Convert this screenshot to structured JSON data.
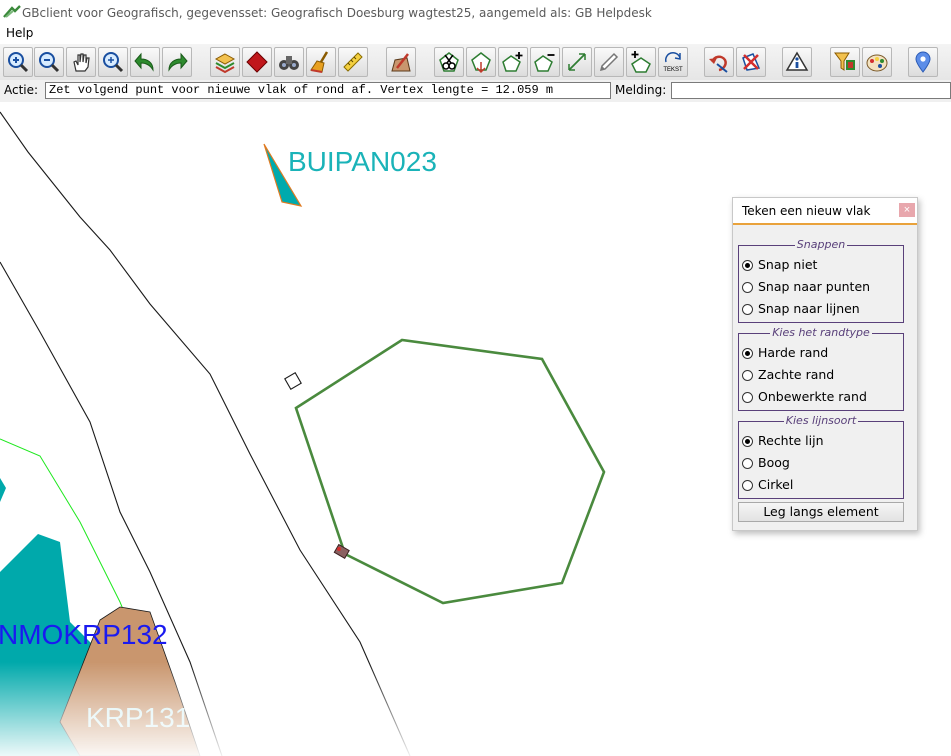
{
  "window": {
    "title": "GBclient voor Geografisch, gegevensset: Geografisch Doesburg wagtest25, aangemeld als: GB Helpdesk"
  },
  "menu": {
    "items": [
      {
        "label": "Help"
      }
    ]
  },
  "toolbar": {
    "buttons": [
      {
        "icon": "zoom-in-icon"
      },
      {
        "icon": "zoom-out-icon"
      },
      {
        "icon": "pan-hand-icon"
      },
      {
        "icon": "zoom-extent-icon"
      },
      {
        "icon": "undo-arrow-icon"
      },
      {
        "icon": "redo-arrow-icon"
      },
      {
        "icon": "layers-icon"
      },
      {
        "icon": "polygon-fill-icon"
      },
      {
        "icon": "binoculars-icon"
      },
      {
        "icon": "broom-icon"
      },
      {
        "icon": "ruler-icon"
      },
      {
        "icon": "edit-object-icon"
      },
      {
        "icon": "cut-icon"
      },
      {
        "icon": "vertex-move-icon"
      },
      {
        "icon": "add-vertex-icon"
      },
      {
        "icon": "remove-vertex-icon"
      },
      {
        "icon": "edit-line-icon"
      },
      {
        "icon": "pen-icon"
      },
      {
        "icon": "add-polygon-icon"
      },
      {
        "icon": "rotate-text-icon"
      },
      {
        "icon": "undo-edit-icon"
      },
      {
        "icon": "delete-icon"
      },
      {
        "icon": "info-icon"
      },
      {
        "icon": "filter-icon"
      },
      {
        "icon": "palette-icon"
      },
      {
        "icon": "location-pin-icon"
      }
    ],
    "text_badge": "TEKST"
  },
  "actionbar": {
    "actie_label": "Actie:",
    "actie_value": "Zet volgend punt voor nieuwe vlak of rond af. Vertex lengte = 12.059 m",
    "melding_label": "Melding:",
    "melding_value": ""
  },
  "map": {
    "labels": [
      {
        "text": "BUIPAN023",
        "color": "#1ab3b8"
      },
      {
        "text": "NMOKRP132",
        "color": "#1a1af0"
      },
      {
        "text": "KRP131",
        "color": "#d9f2f4"
      }
    ],
    "colors": {
      "teal": "#00b3b3",
      "tan": "#c9966e",
      "sketch": "#4a8a3e",
      "boundary": "#1ee81e"
    }
  },
  "panel": {
    "title": "Teken een nieuw vlak",
    "close": "×",
    "groups": [
      {
        "legend": "Snappen",
        "options": [
          {
            "label": "Snap niet",
            "selected": true
          },
          {
            "label": "Snap naar punten",
            "selected": false
          },
          {
            "label": "Snap naar lijnen",
            "selected": false
          }
        ]
      },
      {
        "legend": "Kies het randtype",
        "options": [
          {
            "label": "Harde rand",
            "selected": true
          },
          {
            "label": "Zachte rand",
            "selected": false
          },
          {
            "label": "Onbewerkte rand",
            "selected": false
          }
        ]
      },
      {
        "legend": "Kies lijnsoort",
        "options": [
          {
            "label": "Rechte lijn",
            "selected": true
          },
          {
            "label": "Boog",
            "selected": false
          },
          {
            "label": "Cirkel",
            "selected": false
          }
        ]
      }
    ],
    "button": "Leg langs element"
  }
}
